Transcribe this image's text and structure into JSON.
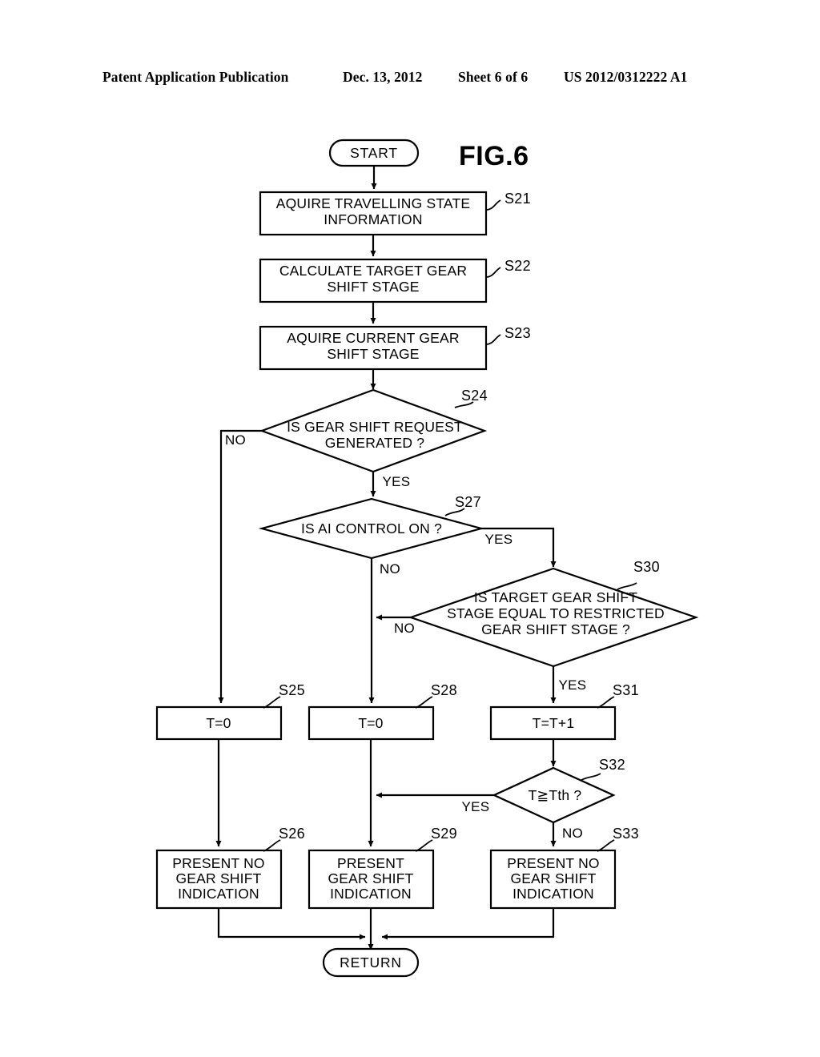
{
  "header": {
    "publication": "Patent Application Publication",
    "date": "Dec. 13, 2012",
    "sheet": "Sheet 6 of 6",
    "patent_number": "US 2012/0312222 A1"
  },
  "figure": {
    "label": "FIG.6"
  },
  "nodes": {
    "start": {
      "text": "START",
      "type": "terminal"
    },
    "s21": {
      "text": "AQUIRE TRAVELLING STATE INFORMATION",
      "line1": "AQUIRE TRAVELLING STATE",
      "line2": "INFORMATION",
      "step": "S21",
      "type": "process"
    },
    "s22": {
      "text": "CALCULATE TARGET GEAR SHIFT STAGE",
      "line1": "CALCULATE TARGET GEAR",
      "line2": "SHIFT STAGE",
      "step": "S22",
      "type": "process"
    },
    "s23": {
      "text": "AQUIRE CURRENT GEAR SHIFT STAGE",
      "line1": "AQUIRE CURRENT GEAR",
      "line2": "SHIFT STAGE",
      "step": "S23",
      "type": "process"
    },
    "s24": {
      "text": "IS GEAR SHIFT REQUEST GENERATED ?",
      "line1": "IS GEAR SHIFT REQUEST",
      "line2": "GENERATED ?",
      "step": "S24",
      "type": "decision",
      "no_label": "NO",
      "yes_label": "YES"
    },
    "s27": {
      "text": "IS AI CONTROL ON ?",
      "line1": "IS AI CONTROL ON ?",
      "step": "S27",
      "type": "decision",
      "yes_label": "YES",
      "no_label": "NO"
    },
    "s30": {
      "text": "IS TARGET GEAR SHIFT STAGE EQUAL TO RESTRICTED GEAR SHIFT STAGE ?",
      "line1": "IS TARGET GEAR SHIFT",
      "line2": "STAGE EQUAL TO RESTRICTED",
      "line3": "GEAR SHIFT STAGE ?",
      "step": "S30",
      "no_label": "NO",
      "yes_label": "YES",
      "type": "decision"
    },
    "s25": {
      "text": "T=0",
      "step": "S25",
      "type": "process"
    },
    "s28": {
      "text": "T=0",
      "step": "S28",
      "type": "process"
    },
    "s31": {
      "text": "T=T+1",
      "step": "S31",
      "type": "process"
    },
    "s32": {
      "text": "T≧Tth ?",
      "step": "S32",
      "type": "decision",
      "yes_label": "YES",
      "no_label": "NO"
    },
    "s26": {
      "line1": "PRESENT NO",
      "line2": "GEAR SHIFT",
      "line3": "INDICATION",
      "text": "PRESENT NO GEAR SHIFT INDICATION",
      "step": "S26",
      "type": "process"
    },
    "s29": {
      "line1": "PRESENT",
      "line2": "GEAR SHIFT",
      "line3": "INDICATION",
      "text": "PRESENT GEAR SHIFT INDICATION",
      "step": "S29",
      "type": "process"
    },
    "s33": {
      "line1": "PRESENT NO",
      "line2": "GEAR SHIFT",
      "line3": "INDICATION",
      "text": "PRESENT NO GEAR SHIFT INDICATION",
      "step": "S33",
      "type": "process"
    },
    "return": {
      "text": "RETURN",
      "type": "terminal"
    }
  }
}
